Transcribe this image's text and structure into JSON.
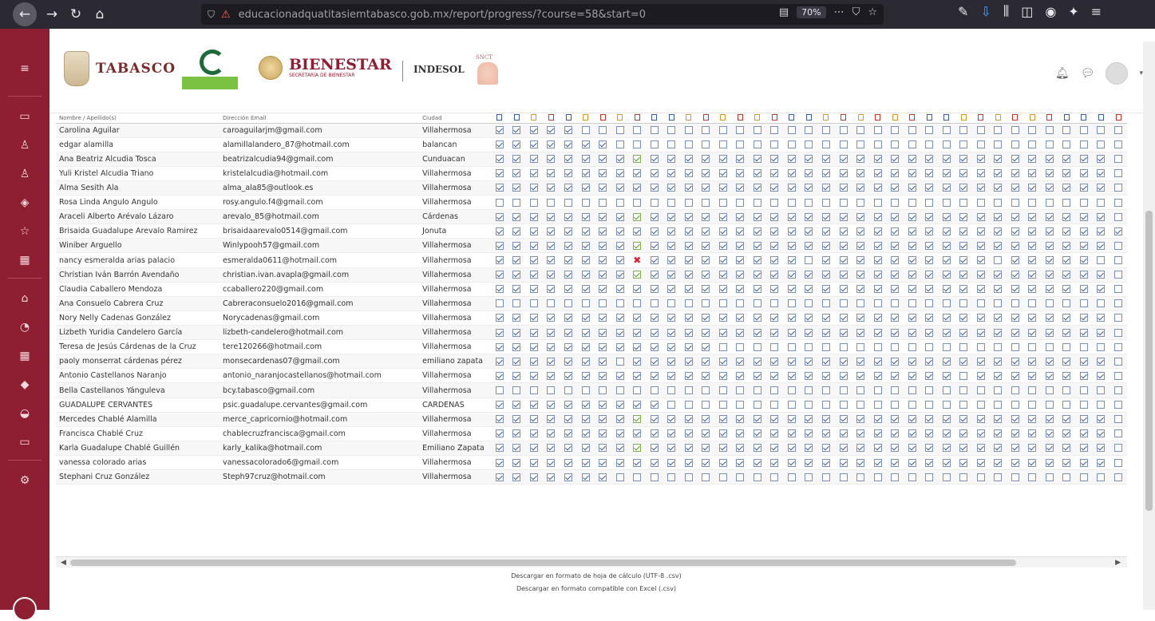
{
  "browser": {
    "url_prefix": "educacionadquatitasiemtabasco.gob.mx",
    "url_host": "iemtabasco.gob.mx",
    "url_rest": "/report/progress/?course=58&start=0",
    "zoom": "70%"
  },
  "header": {
    "tabasco": "TABASCO",
    "bienestar": "BIENESTAR",
    "bienestar_sub": "SECRETARÍA DE BIENESTAR",
    "indesol": "INDESOL",
    "snct": "SNCT"
  },
  "table": {
    "columns": [
      "Nombre / Apellido(s)",
      "Dirección Email",
      "Ciudad"
    ],
    "activity_icons": [
      "chk",
      "chk",
      "doc",
      "quiz",
      "chk",
      "doc",
      "quiz",
      "doc",
      "quiz",
      "chk",
      "chk",
      "doc",
      "quiz",
      "doc",
      "quiz",
      "doc",
      "quiz",
      "chk",
      "chk",
      "doc",
      "quiz",
      "doc",
      "quiz",
      "doc",
      "quiz",
      "chk",
      "chk",
      "doc",
      "quiz",
      "doc",
      "quiz",
      "doc",
      "quiz",
      "chk",
      "chk",
      "chk",
      "quiz"
    ],
    "rows": [
      {
        "name": "Carolina Aguilar",
        "email": "caroaguilarjm@gmail.com",
        "city": "Villahermosa",
        "progress": "DDDDDEEEEEEEEEEEEEEEEEEEEEEEEEEEEEEEE"
      },
      {
        "name": "edgar alamilla",
        "email": "alamillalandero_87@hotmail.com",
        "city": "balancan",
        "progress": "DDDDDDDEEEEEEEEEEEEEEEEEEEEEEEEEEEEEE"
      },
      {
        "name": "Ana Beatriz Alcudia Tosca",
        "email": "beatrizalcudia94@gmail.com",
        "city": "Cunduacan",
        "progress": "DDDDDDDDPDDDDDDDDDDDDDDDDDDDDDDDDDDDE"
      },
      {
        "name": "Yuli Kristel Alcudia Triano",
        "email": "kristelalcudia@hotmail.com",
        "city": "Villahermosa",
        "progress": "DDDDDDDDDDDDDDDDDDDDDDDDDDDDDDDDDDDDE"
      },
      {
        "name": "Alma Sesith Ala",
        "email": "alma_ala85@outlook.es",
        "city": "Villahermosa",
        "progress": "DDDDDDDDDDDDDDDDDDDDDDDDDDDDDDDDDDDDE"
      },
      {
        "name": "Rosa Linda Angulo Angulo",
        "email": "rosy.angulo.f4@gmail.com",
        "city": "Villahermosa",
        "progress": "EEEEEEEEEEEEEEEEEEEEEEEEEEEEEEEEEEEEE"
      },
      {
        "name": "Araceli Alberto Arévalo Lázaro",
        "email": "arevalo_85@hotmail.com",
        "city": "Cárdenas",
        "progress": "DDDDDDDDPDDDDDDDDDDDDDDDDDDDDDDDDDDDE"
      },
      {
        "name": "Brisaida Guadalupe Arevalo Ramirez",
        "email": "brisaidaarevalo0514@gmail.com",
        "city": "Jonuta",
        "progress": "DDDDDDDDDDDDDDDDDDDDDDDDDDDDDDDDDDDDD"
      },
      {
        "name": "Winiber Arguello",
        "email": "Winlypooh57@gmail.com",
        "city": "Villahermosa",
        "progress": "DDDDDDDDPDDDDDDDDDDDDDDDDDDDDDDDDDDDE"
      },
      {
        "name": "nancy esmeralda arias palacio",
        "email": "esmeralda0611@hotmail.com",
        "city": "Villahermosa",
        "progress": "DDDDDDDDFDDDDDDDDDEDDDDDDDDDDEDDDDDEE"
      },
      {
        "name": "Christian Iván Barrón Avendaño",
        "email": "christian.ivan.avapla@gmail.com",
        "city": "Villahermosa",
        "progress": "DDDDDDDDPDDDDDDDDDDDDDDDDDDDDDDDDDDDE"
      },
      {
        "name": "Claudia Caballero Mendoza",
        "email": "ccaballero220@gmail.com",
        "city": "Villahermosa",
        "progress": "DDDDDDDDDDDDDDDDDDDDDDDDDDDDDDDDDDDDE"
      },
      {
        "name": "Ana Consuelo Cabrera Cruz",
        "email": "Cabreraconsuelo2016@gmail.com",
        "city": "Villahermosa",
        "progress": "EEEEEEEEEEEEEEEEEEEEEEEEEEEEEEEEEEEEE"
      },
      {
        "name": "Nory Nelly Cadenas González",
        "email": "Norycadenas@gmail.com",
        "city": "Villahermosa",
        "progress": "DDDDDDDDDDDDDDDDDDDDDDDDDDDDDDDDDDDDE"
      },
      {
        "name": "Lizbeth Yuridia Candelero García",
        "email": "lizbeth-candelero@hotmail.com",
        "city": "Villahermosa",
        "progress": "DDDDDDDDDDDDDDDDDDDDDDDDDDDDDDDDDDDDE"
      },
      {
        "name": "Teresa de Jesús Cárdenas de la Cruz",
        "email": "tere120266@hotmail.com",
        "city": "Villahermosa",
        "progress": "DDDDDDDDDDDDDEEEEEEEEEEEEEEEEEEEEEEEE"
      },
      {
        "name": "paoly monserrat cárdenas pérez",
        "email": "monsecardenas07@gmail.com",
        "city": "emiliano zapata",
        "progress": "DDDDDDDEDDDDDDDDDDDDDDDDDDDDDDDDDDDDE"
      },
      {
        "name": "Antonio Castellanos Naranjo",
        "email": "antonio_naranjocastellanos@hotmail.com",
        "city": "Villahermosa",
        "progress": "DDDDDDDDDDDDDDDDDDDDDDDDDDDEDDDDDDDDE"
      },
      {
        "name": "Bella Castellanos Yánguleva",
        "email": "bcy.tabasco@gmail.com",
        "city": "Villahermosa",
        "progress": "EEEEEEEEEEEEEEEEEEEEEEEEEEEEEEEEEEEEE"
      },
      {
        "name": "GUADALUPE CERVANTES",
        "email": "psic.guadalupe.cervantes@gmail.com",
        "city": "CARDENAS",
        "progress": "DDDDDDDDDDEEEEEEEEEEEEEEEEEEEEEEEEEEE"
      },
      {
        "name": "Mercedes Chablé Alamilla",
        "email": "merce_capricornio@hotmail.com",
        "city": "Villahermosa",
        "progress": "DDDDDDDDPDDDDDDDDDDDDDDDDDDDDDDDDDDDE"
      },
      {
        "name": "Francisca Chablé Cruz",
        "email": "chablecruzfrancisca@gmail.com",
        "city": "Villahermosa",
        "progress": "DDDDDDDDDDDDDDDDDDDDDDDDDDDDDDDDDDDDE"
      },
      {
        "name": "Karla Guadalupe Chablé Guillén",
        "email": "karly_kalika@hotmail.com",
        "city": "Emiliano Zapata",
        "progress": "DDDDDDDDPDDDDDDDDDDDDDDDDDDDDDDDDDDDE"
      },
      {
        "name": "vanessa colorado arias",
        "email": "vanessacolorado6@gmail.com",
        "city": "Villahermosa",
        "progress": "DDDDDDDDDDDDDDDDDDDDDDDDDDDDDDDDDDDDE"
      },
      {
        "name": "Stephani Cruz González",
        "email": "Steph97cruz@hotmail.com",
        "city": "Villahermosa",
        "progress": "DDDDDDDEEEEEEEEEEEEEEEEEEEEEEEEEEEEEE"
      }
    ]
  },
  "downloads": {
    "ods": "Descargar en formato de hoja de cálculo (UTF-8 .csv)",
    "excel": "Descargar en formato compatible con Excel (.csv)"
  },
  "colors": {
    "sidebar": "#8e1e32",
    "check_done": "#3d5e9e",
    "check_pass": "#5a9a2e",
    "check_fail": "#dd2233"
  }
}
